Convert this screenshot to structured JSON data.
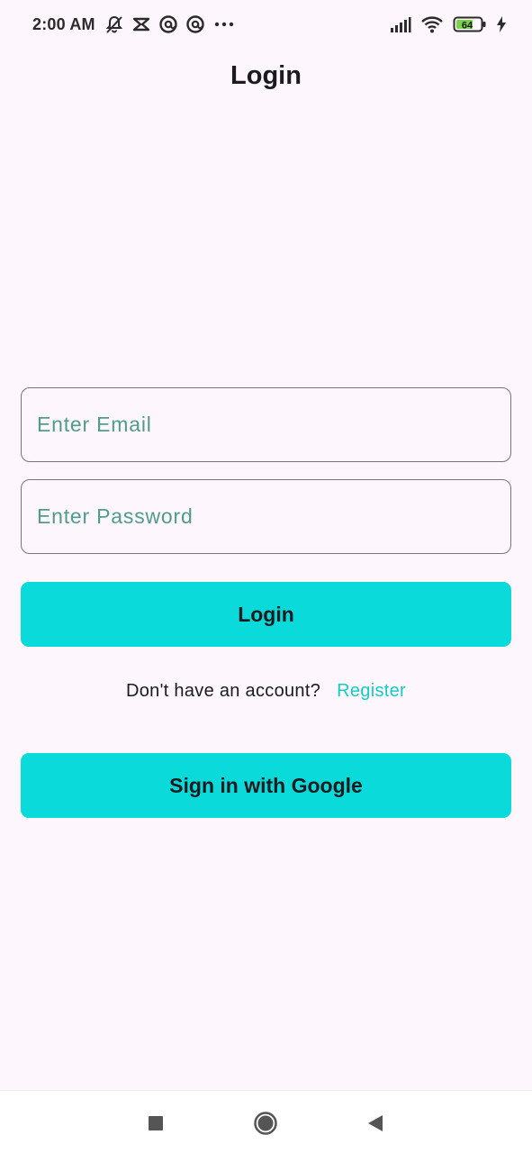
{
  "status_bar": {
    "time": "2:00 AM",
    "left_icons": [
      "muted-bell-icon",
      "capcut-icon",
      "at-sign-icon",
      "at-sign-icon",
      "more-dots-icon"
    ],
    "battery_level": "64",
    "right_icons": [
      "signal-icon",
      "wifi-icon",
      "battery-icon",
      "charging-icon"
    ]
  },
  "header": {
    "title": "Login"
  },
  "form": {
    "email": {
      "placeholder": "Enter Email",
      "value": ""
    },
    "password": {
      "placeholder": "Enter Password",
      "value": ""
    },
    "login_label": "Login",
    "register_prompt": "Don't have an account?",
    "register_link": "Register",
    "google_label": "Sign in with Google"
  },
  "colors": {
    "background": "#fdf6fd",
    "accent": "#0adada",
    "link": "#12cdc8",
    "placeholder": "#4f9c8e",
    "battery_fill": "#7bd34a"
  },
  "nav_bar": {
    "items": [
      "recent-apps-icon",
      "home-icon",
      "back-icon"
    ]
  }
}
